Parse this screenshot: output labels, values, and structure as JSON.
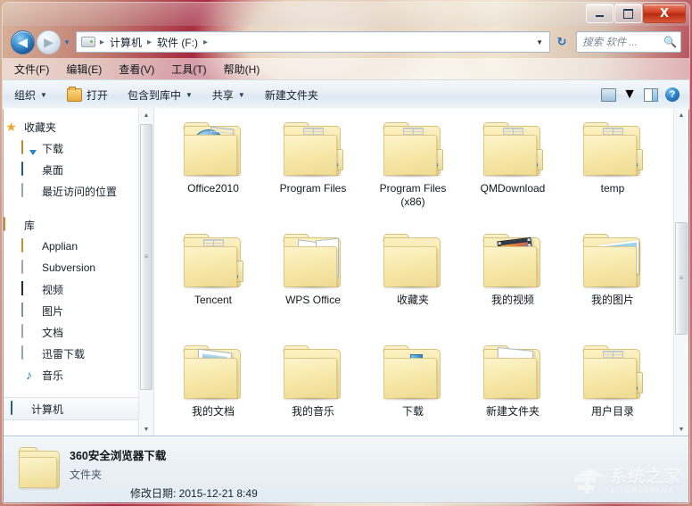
{
  "window": {
    "controls": {
      "minimize_label": "Minimize",
      "maximize_label": "Maximize",
      "close_label": "X"
    }
  },
  "addressbar": {
    "back_glyph": "◀",
    "forward_glyph": "▶",
    "history_glyph": "▼",
    "drive_icon": "drive-icon",
    "crumbs": [
      "计算机",
      "软件 (F:)"
    ],
    "separator": "▸",
    "dropdown_glyph": "▼",
    "refresh_glyph": "↻",
    "search": {
      "placeholder": "搜索 软件 ...",
      "value": "",
      "icon": "search-icon"
    }
  },
  "menubar": {
    "items": [
      {
        "label": "文件(F)"
      },
      {
        "label": "编辑(E)"
      },
      {
        "label": "查看(V)"
      },
      {
        "label": "工具(T)"
      },
      {
        "label": "帮助(H)"
      }
    ]
  },
  "commandbar": {
    "organize": {
      "label": "组织",
      "caret": "▼"
    },
    "open": {
      "label": "打开",
      "icon": "open-folder-icon"
    },
    "include_in_library": {
      "label": "包含到库中",
      "caret": "▼"
    },
    "share": {
      "label": "共享",
      "caret": "▼"
    },
    "new_folder": {
      "label": "新建文件夹"
    },
    "view_icon": "view-icon",
    "view_caret": "▼",
    "preview_pane_icon": "preview-pane-icon",
    "help_icon": "help-icon",
    "help_glyph": "?"
  },
  "navpane": {
    "favorites": {
      "label": "收藏夹",
      "icon": "star-icon",
      "glyph": "★",
      "items": [
        {
          "label": "下载",
          "icon": "downloads-icon"
        },
        {
          "label": "桌面",
          "icon": "desktop-icon"
        },
        {
          "label": "最近访问的位置",
          "icon": "recent-places-icon"
        }
      ]
    },
    "libraries": {
      "label": "库",
      "icon": "library-icon",
      "items": [
        {
          "label": "Applian",
          "icon": "folder-icon"
        },
        {
          "label": "Subversion",
          "icon": "document-icon"
        },
        {
          "label": "视频",
          "icon": "video-icon"
        },
        {
          "label": "图片",
          "icon": "pictures-icon"
        },
        {
          "label": "文档",
          "icon": "documents-icon"
        },
        {
          "label": "迅雷下载",
          "icon": "thunder-download-icon"
        },
        {
          "label": "音乐",
          "icon": "music-icon",
          "glyph": "♪"
        }
      ]
    },
    "computer": {
      "label": "计算机",
      "icon": "computer-icon",
      "selected": true
    },
    "scrollbar": {
      "up_glyph": "▲",
      "down_glyph": "▼",
      "grip": "≡"
    }
  },
  "content": {
    "scrollbar": {
      "up_glyph": "▲",
      "down_glyph": "▼",
      "grip": "≡"
    },
    "items": [
      {
        "label": "Office2010",
        "icon": "folder-disc-icon",
        "variant": "disc"
      },
      {
        "label": "Program Files",
        "icon": "folder-papers-icon",
        "variant": "papers"
      },
      {
        "label": "Program Files (x86)",
        "icon": "folder-papers-icon",
        "variant": "papers"
      },
      {
        "label": "QMDownload",
        "icon": "folder-papers-icon",
        "variant": "papers"
      },
      {
        "label": "temp",
        "icon": "folder-papers-icon",
        "variant": "papers"
      },
      {
        "label": "Tencent",
        "icon": "folder-papers-icon",
        "variant": "papers"
      },
      {
        "label": "WPS Office",
        "icon": "folder-sheets-icon",
        "variant": "sheets"
      },
      {
        "label": "收藏夹",
        "icon": "folder-star-icon",
        "variant": "star"
      },
      {
        "label": "我的视频",
        "icon": "folder-video-icon",
        "variant": "film"
      },
      {
        "label": "我的图片",
        "icon": "folder-picture-icon",
        "variant": "photo"
      },
      {
        "label": "我的文档",
        "icon": "folder-document-icon",
        "variant": "doc"
      },
      {
        "label": "我的音乐",
        "icon": "folder-music-icon",
        "variant": "music",
        "glyph": "♪"
      },
      {
        "label": "下载",
        "icon": "folder-download-icon",
        "variant": "download"
      },
      {
        "label": "新建文件夹",
        "icon": "folder-new-icon",
        "variant": "new"
      },
      {
        "label": "用户目录",
        "icon": "folder-papers-icon",
        "variant": "papers"
      }
    ]
  },
  "details": {
    "icon": "folder-icon",
    "name": "360安全浏览器下载",
    "type": "文件夹",
    "date_label": "修改日期:",
    "date_value": "2015-12-21 8:49",
    "date_full": "修改日期: 2015-12-21 8:49"
  },
  "watermark": {
    "cn": "系统之家",
    "en": "XITONGZHIJIA"
  },
  "colors": {
    "accent": "#2a84c8",
    "folder": "#f4e39e",
    "close_button": "#cf3a1b",
    "star": "#f5a623"
  }
}
